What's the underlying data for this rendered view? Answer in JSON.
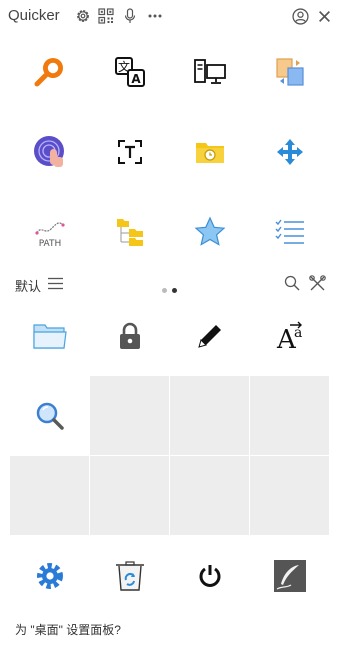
{
  "app": {
    "title": "Quicker"
  },
  "titlebar": {
    "icons": [
      "gear-icon",
      "qr-code-icon",
      "microphone-icon",
      "more-icon",
      "user-circle-icon",
      "close-icon"
    ]
  },
  "top_grid": {
    "items": [
      {
        "icon": "search-key-icon",
        "color": "#f07a0e"
      },
      {
        "icon": "translate-icon",
        "color": "#111111"
      },
      {
        "icon": "computers-icon",
        "color": "#111111"
      },
      {
        "icon": "clipboard-swap-icon",
        "color": "#f2a33a"
      },
      {
        "icon": "touch-fingerprint-icon",
        "color": "#5a4fc8"
      },
      {
        "icon": "text-recognition-icon",
        "color": "#111111"
      },
      {
        "icon": "folder-clock-icon",
        "color": "#f5c518"
      },
      {
        "icon": "move-arrows-icon",
        "color": "#2a8bd8"
      },
      {
        "icon": "path-icon",
        "label": "PATH",
        "color": "#555555"
      },
      {
        "icon": "folder-tree-icon",
        "color": "#f5c518"
      },
      {
        "icon": "star-icon",
        "color": "#6fb3e8"
      },
      {
        "icon": "checklist-icon",
        "color": "#4a90d9"
      }
    ]
  },
  "panel_bar": {
    "label": "默认",
    "pages": 2,
    "active_page": 2
  },
  "bottom_grid": {
    "items": [
      {
        "icon": "folder-icon",
        "color": "#4aa3df"
      },
      {
        "icon": "lock-icon",
        "color": "#555555"
      },
      {
        "icon": "pencil-icon",
        "color": "#111111"
      },
      {
        "icon": "font-size-icon",
        "color": "#111111"
      },
      {
        "icon": "magnifier-icon",
        "color": "#3a7fd0"
      }
    ],
    "empty_slots": 7
  },
  "dock": {
    "items": [
      {
        "icon": "settings-gear-icon",
        "color": "#2a7bd8"
      },
      {
        "icon": "recycle-bin-icon",
        "color": "#2a8bd8"
      },
      {
        "icon": "power-icon",
        "color": "#111111"
      },
      {
        "icon": "feather-note-icon",
        "color": "#555555"
      }
    ]
  },
  "footer": {
    "text": "为 \"桌面\" 设置面板?"
  }
}
